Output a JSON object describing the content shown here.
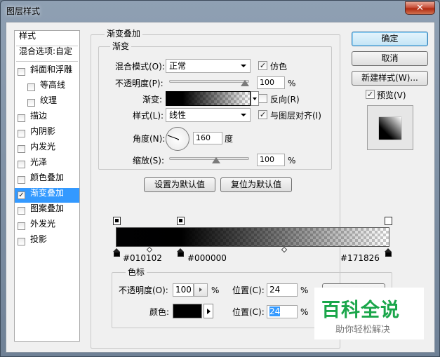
{
  "window": {
    "title": "图层样式",
    "close_glyph": "✕"
  },
  "sidebar": {
    "header": "样式",
    "blend": "混合选项:自定",
    "items": [
      {
        "label": "斜面和浮雕",
        "checked": false
      },
      {
        "label": "等高线",
        "checked": false
      },
      {
        "label": "纹理",
        "checked": false
      },
      {
        "label": "描边",
        "checked": false
      },
      {
        "label": "内阴影",
        "checked": false
      },
      {
        "label": "内发光",
        "checked": false
      },
      {
        "label": "光泽",
        "checked": false
      },
      {
        "label": "颜色叠加",
        "checked": false
      },
      {
        "label": "渐变叠加",
        "checked": true
      },
      {
        "label": "图案叠加",
        "checked": false
      },
      {
        "label": "外发光",
        "checked": false
      },
      {
        "label": "投影",
        "checked": false
      }
    ]
  },
  "overlay": {
    "group_title": "渐变叠加",
    "sub_title": "渐变",
    "blend_mode_label": "混合模式(O):",
    "blend_mode_value": "正常",
    "dither_label": "仿色",
    "opacity_label": "不透明度(P):",
    "opacity_value": "100",
    "opacity_percent": 100,
    "percent": "%",
    "gradient_label": "渐变:",
    "reverse_label": "反向(R)",
    "style_label": "样式(L):",
    "style_value": "线性",
    "align_label": "与图层对齐(I)",
    "angle_label": "角度(N):",
    "angle_value": "160",
    "angle_unit": "度",
    "scale_label": "缩放(S):",
    "scale_value": "100",
    "scale_percent": 100,
    "set_default": "设置为默认值",
    "reset_default": "复位为默认值"
  },
  "buttons": {
    "ok": "确定",
    "cancel": "取消",
    "new_style": "新建样式(W)...",
    "preview": "预览(V)"
  },
  "gradient_editor": {
    "stop1": "#010102",
    "stop2": "#000000",
    "stop3": "#171826",
    "color_stop_title": "色标",
    "opacity_label": "不透明度(O):",
    "opacity_value": "100",
    "percent": "%",
    "location_label": "位置(C):",
    "location_value_1": "24",
    "color_label": "颜色:",
    "location_value_2": "24"
  },
  "watermark": {
    "title": "百科全说",
    "subtitle": "助你轻松解决"
  }
}
